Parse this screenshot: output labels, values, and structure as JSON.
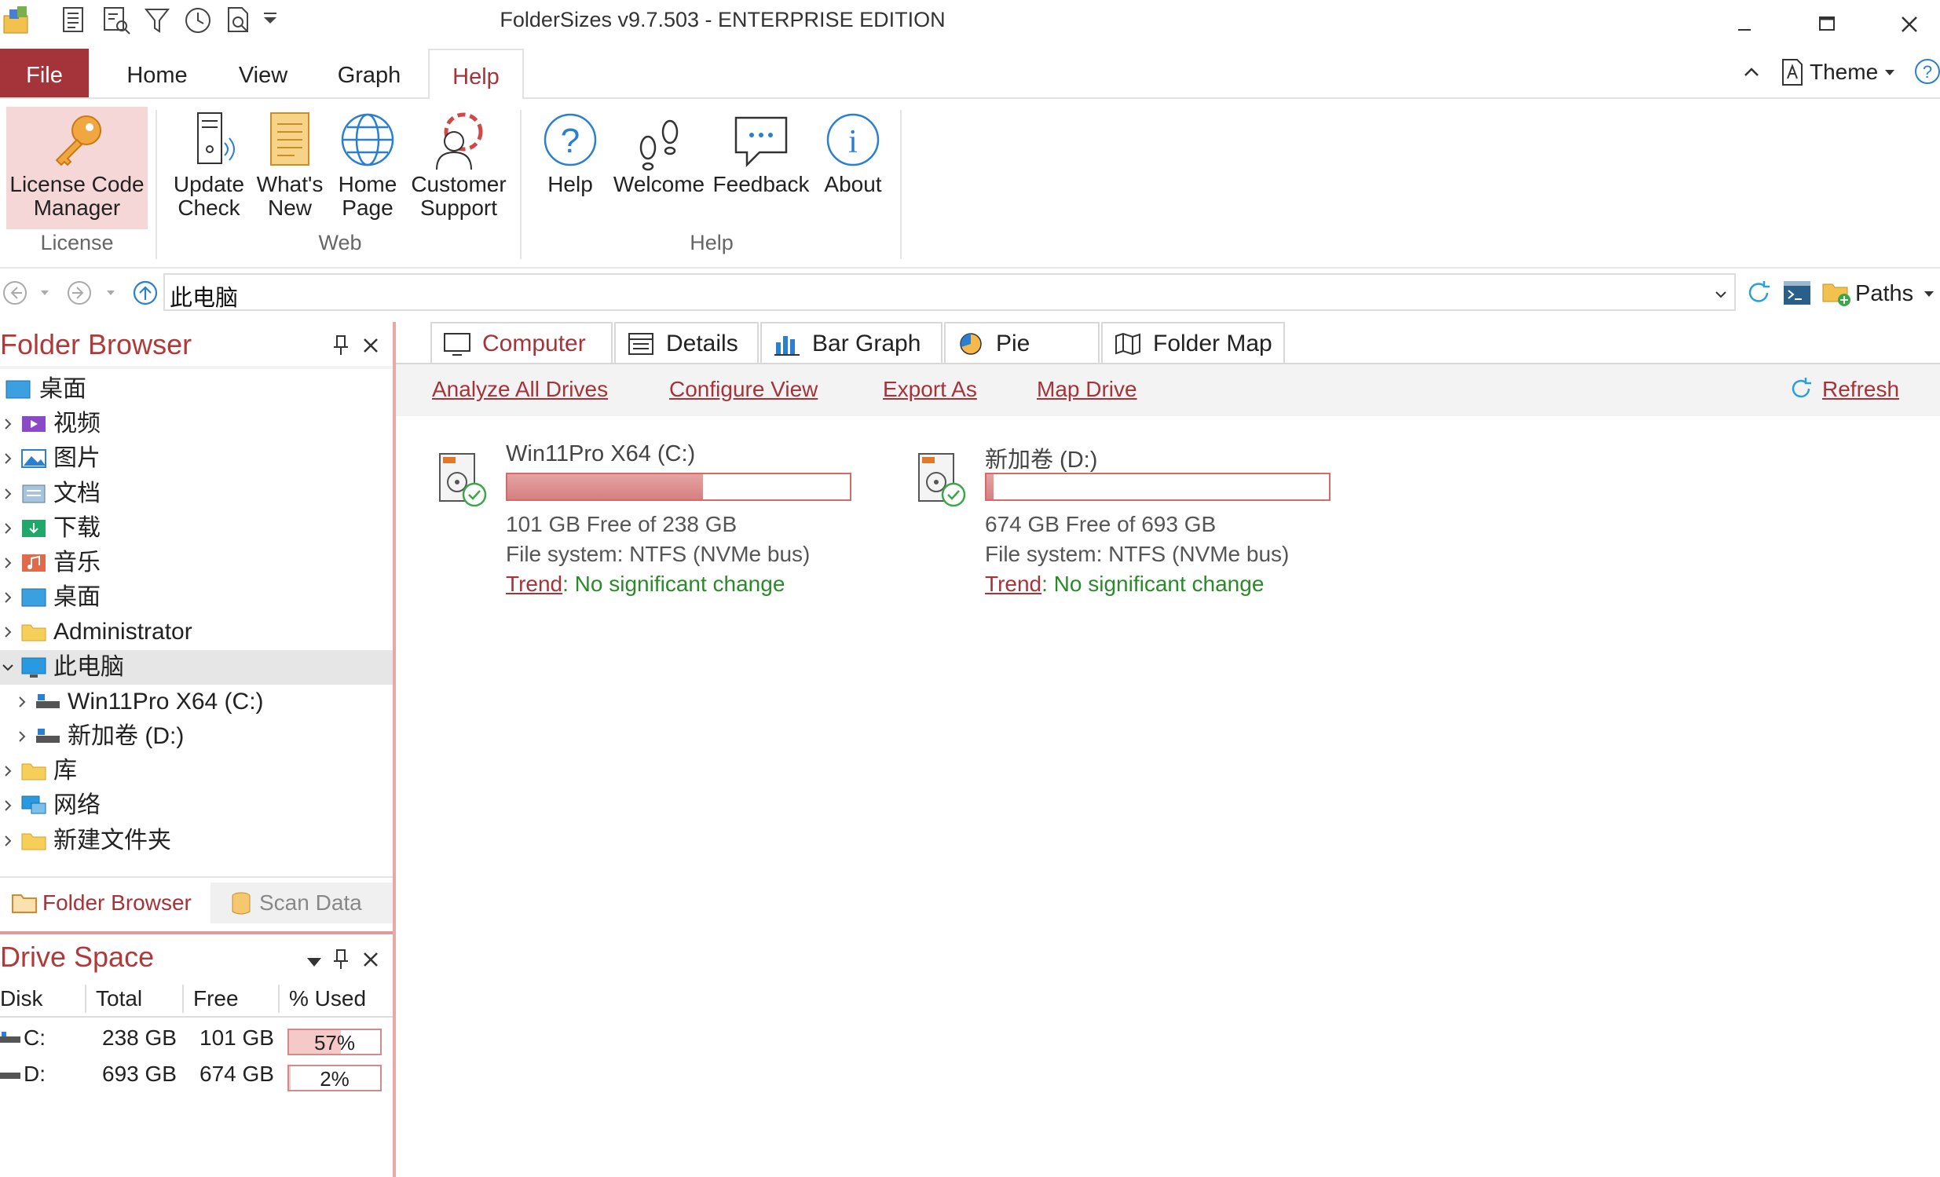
{
  "app": {
    "title": "FolderSizes v9.7.503 - ENTERPRISE EDITION"
  },
  "ribbon_tabs": {
    "file": "File",
    "home": "Home",
    "view": "View",
    "graph": "Graph",
    "help": "Help"
  },
  "ribbon_right": {
    "theme": "Theme"
  },
  "ribbon": {
    "license": {
      "license_code_manager": "License Code Manager",
      "group": "License"
    },
    "web": {
      "update_check": "Update Check",
      "whats_new": "What's New",
      "home_page": "Home Page",
      "customer_support": "Customer Support",
      "group": "Web"
    },
    "help": {
      "help": "Help",
      "welcome": "Welcome",
      "feedback": "Feedback",
      "about": "About",
      "group": "Help"
    }
  },
  "address": {
    "path": "此电脑",
    "paths_label": "Paths"
  },
  "folder_browser": {
    "title": "Folder Browser",
    "tree": [
      {
        "label": "桌面",
        "icon": "desktop-icon"
      },
      {
        "label": "视频",
        "icon": "video-icon"
      },
      {
        "label": "图片",
        "icon": "pictures-icon"
      },
      {
        "label": "文档",
        "icon": "documents-icon"
      },
      {
        "label": "下载",
        "icon": "downloads-icon"
      },
      {
        "label": "音乐",
        "icon": "music-icon"
      },
      {
        "label": "桌面",
        "icon": "desktop-icon"
      },
      {
        "label": "Administrator",
        "icon": "folder-icon"
      },
      {
        "label": "此电脑",
        "icon": "computer-icon"
      },
      {
        "label": "Win11Pro X64 (C:)",
        "icon": "drive-icon"
      },
      {
        "label": "新加卷 (D:)",
        "icon": "drive-icon"
      },
      {
        "label": "库",
        "icon": "folder-icon"
      },
      {
        "label": "网络",
        "icon": "network-icon"
      },
      {
        "label": "新建文件夹",
        "icon": "folder-icon"
      }
    ],
    "bottom_tabs": {
      "folder_browser": "Folder Browser",
      "scan_data": "Scan Data"
    }
  },
  "drive_space": {
    "title": "Drive Space",
    "columns": [
      "Disk",
      "Total",
      "Free",
      "% Used"
    ],
    "rows": [
      {
        "disk": "C:",
        "total": "238 GB",
        "free": "101 GB",
        "used": "57%",
        "used_value": 57
      },
      {
        "disk": "D:",
        "total": "693 GB",
        "free": "674 GB",
        "used": "2%",
        "used_value": 2
      }
    ]
  },
  "view_tabs": {
    "computer": "Computer",
    "details": "Details",
    "bar_graph": "Bar Graph",
    "pie_graph": "Pie Graph",
    "folder_map": "Folder Map"
  },
  "commands": {
    "analyze_all": "Analyze All Drives",
    "configure_view": "Configure View",
    "export_as": "Export As",
    "map_drive": "Map Drive",
    "refresh": "Refresh"
  },
  "drives": [
    {
      "name": "Win11Pro X64 (C:)",
      "free_line": "101 GB Free of 238 GB",
      "fs_line": "File system: NTFS (NVMe bus)",
      "trend_label": "Trend",
      "trend_value": ": No significant change",
      "used_fraction": 0.57
    },
    {
      "name": "新加卷 (D:)",
      "free_line": "674 GB Free of 693 GB",
      "fs_line": "File system: NTFS (NVMe bus)",
      "trend_label": "Trend",
      "trend_value": ": No significant change",
      "used_fraction": 0.02
    }
  ],
  "colors": {
    "accent": "#a4343a",
    "bar_fill": "#d48080",
    "trend_green": "#2a8a2a"
  }
}
